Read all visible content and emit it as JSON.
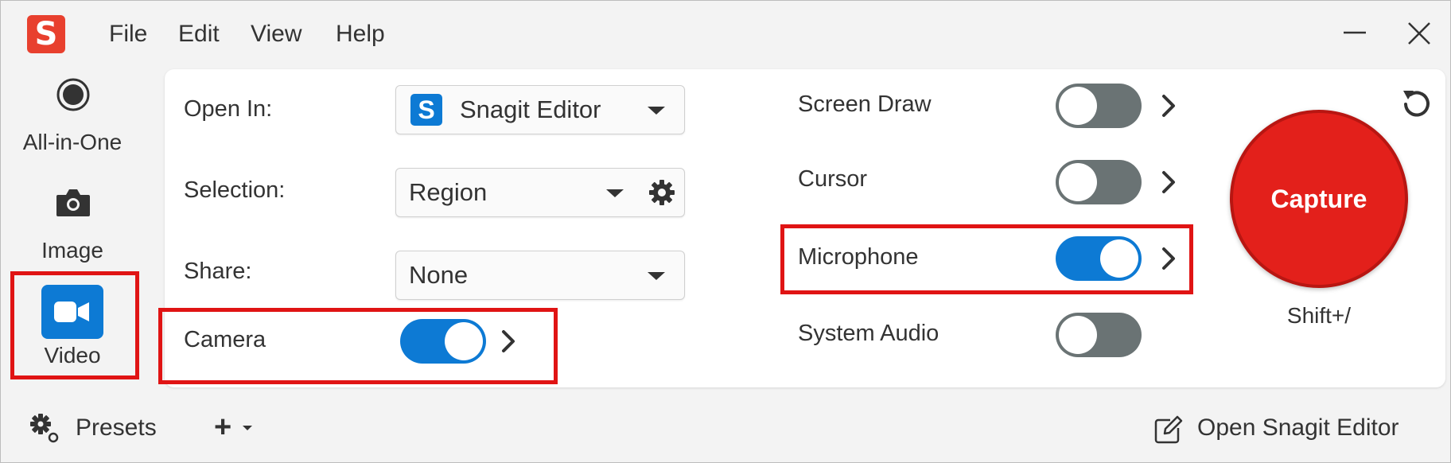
{
  "app": {
    "logo_letter": "S"
  },
  "menu": [
    "File",
    "Edit",
    "View",
    "Help"
  ],
  "sidebar": [
    {
      "label": "All-in-One",
      "icon": "record-icon",
      "selected": false
    },
    {
      "label": "Image",
      "icon": "camera-icon",
      "selected": false
    },
    {
      "label": "Video",
      "icon": "video-camera-icon",
      "selected": true
    }
  ],
  "settings": {
    "open_in": {
      "label": "Open In:",
      "value": "Snagit Editor",
      "icon": "snagit-editor-icon"
    },
    "selection": {
      "label": "Selection:",
      "value": "Region"
    },
    "share": {
      "label": "Share:",
      "value": "None"
    },
    "camera": {
      "label": "Camera",
      "on": true
    }
  },
  "toggles": [
    {
      "label": "Screen Draw",
      "on": false,
      "has_more": true
    },
    {
      "label": "Cursor",
      "on": false,
      "has_more": true
    },
    {
      "label": "Microphone",
      "on": true,
      "has_more": true
    },
    {
      "label": "System Audio",
      "on": false,
      "has_more": false
    }
  ],
  "capture": {
    "label": "Capture",
    "shortcut": "Shift+/"
  },
  "footer": {
    "presets": "Presets",
    "add": "+",
    "open_editor": "Open Snagit Editor"
  },
  "colors": {
    "accent": "#0d7ad4",
    "toggle_off": "#6a7374",
    "capture": "#e3201b",
    "highlight": "#e01414",
    "logo": "#e8402e"
  }
}
